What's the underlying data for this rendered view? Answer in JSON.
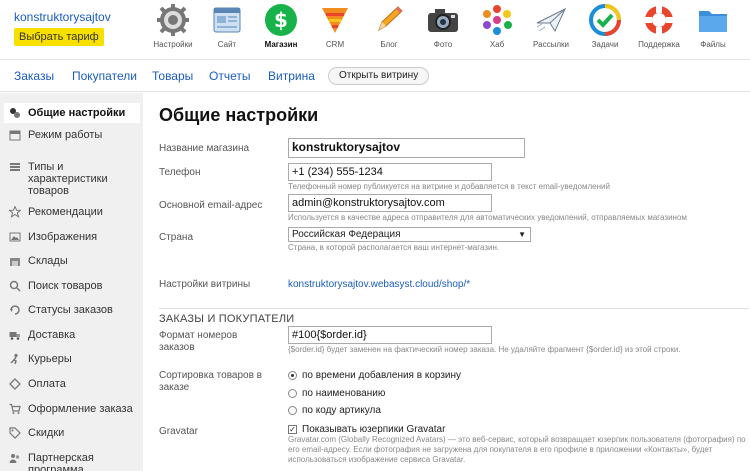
{
  "account": {
    "name": "konstruktorysajtov",
    "plan_button": "Выбрать тариф"
  },
  "apps": [
    {
      "label": "Настройки",
      "icon": "gear-icon"
    },
    {
      "label": "Сайт",
      "icon": "site-icon"
    },
    {
      "label": "Магазин",
      "icon": "shop-icon"
    },
    {
      "label": "CRM",
      "icon": "crm-icon"
    },
    {
      "label": "Блог",
      "icon": "pencil-icon"
    },
    {
      "label": "Фото",
      "icon": "camera-icon"
    },
    {
      "label": "Хаб",
      "icon": "hub-icon"
    },
    {
      "label": "Рассылки",
      "icon": "mailer-icon"
    },
    {
      "label": "Задачи",
      "icon": "tasks-icon"
    },
    {
      "label": "Поддержка",
      "icon": "lifebuoy-icon"
    },
    {
      "label": "Файлы",
      "icon": "folder-icon"
    }
  ],
  "subnav": {
    "items": [
      "Заказы",
      "Покупатели",
      "Товары",
      "Отчеты",
      "Витрина"
    ],
    "storefront_button": "Открыть витрину"
  },
  "sidebar": {
    "items": [
      {
        "label": "Общие настройки",
        "icon": "settings-icon"
      },
      {
        "label": "Режим работы",
        "icon": "calendar-icon"
      },
      {
        "label": "Типы и характеристики товаров",
        "icon": "list-icon"
      },
      {
        "label": "Рекомендации",
        "icon": "star-icon"
      },
      {
        "label": "Изображения",
        "icon": "image-icon"
      },
      {
        "label": "Склады",
        "icon": "warehouse-icon"
      },
      {
        "label": "Поиск товаров",
        "icon": "search-icon"
      },
      {
        "label": "Статусы заказов",
        "icon": "status-icon"
      },
      {
        "label": "Доставка",
        "icon": "truck-icon"
      },
      {
        "label": "Курьеры",
        "icon": "courier-icon"
      },
      {
        "label": "Оплата",
        "icon": "payment-icon"
      },
      {
        "label": "Оформление заказа",
        "icon": "cart-icon"
      },
      {
        "label": "Скидки",
        "icon": "discount-icon"
      },
      {
        "label": "Партнерская программа",
        "icon": "affiliate-icon"
      }
    ]
  },
  "main": {
    "title": "Общие настройки",
    "shop_name": {
      "label": "Название магазина",
      "value": "konstruktorysajtov"
    },
    "phone": {
      "label": "Телефон",
      "value": "+1 (234) 555-1234",
      "hint": "Телефонный номер публикуется на витрине и добавляется в текст email-уведомлений"
    },
    "email": {
      "label": "Основной email-адрес",
      "value": "admin@konstruktorysajtov.com",
      "hint": "Используется в качестве адреса отправителя для автоматических уведомлений, отправляемых магазином"
    },
    "country": {
      "label": "Страна",
      "value": "Российская Федерация",
      "hint": "Страна, в которой располагается ваш интернет-магазин."
    },
    "storefront": {
      "label": "Настройки витрины",
      "link": "konstruktorysajtov.webasyst.cloud/shop/*"
    },
    "section_title": "ЗАКАЗЫ И ПОКУПАТЕЛИ",
    "order_format": {
      "label": "Формат номеров заказов",
      "value": "#100{$order.id}",
      "hint": "{$order.id} будет заменен на фактический номер заказа. Не удаляйте фрагмент {$order.id} из этой строки."
    },
    "sorting": {
      "label": "Сортировка товаров в заказе",
      "options": [
        "по времени добавления в корзину",
        "по наименованию",
        "по коду артикула"
      ]
    },
    "gravatar": {
      "label": "Gravatar",
      "checkbox": "Показывать юзерпики Gravatar",
      "description": "Gravatar.com (Globally Recognized Avatars) — это веб-сервис, который возвращает юзерпик пользователя (фотография) по его email-адресу. Если фотография не загружена для покупателя в его профиле в приложении «Контакты», будет использоваться изображение сервиса Gravatar."
    }
  }
}
